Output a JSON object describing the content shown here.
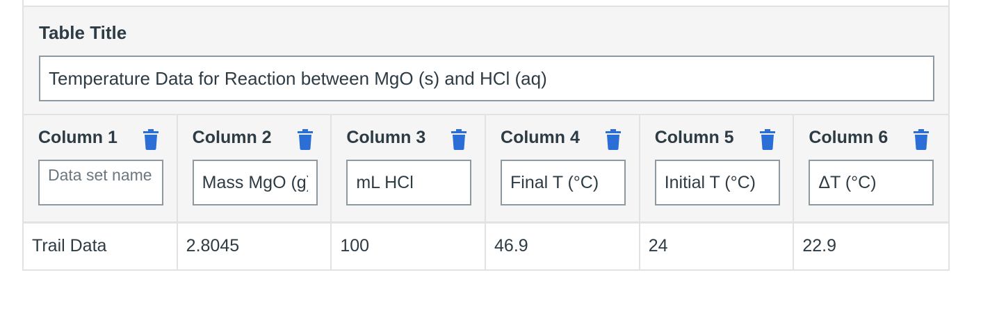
{
  "table": {
    "title_label": "Table Title",
    "title_value": "Temperature Data for Reaction between MgO (s) and HCl (aq)",
    "columns": [
      {
        "label": "Column 1",
        "value": "",
        "placeholder": "Data set name"
      },
      {
        "label": "Column 2",
        "value": "Mass MgO (g)"
      },
      {
        "label": "Column 3",
        "value": "mL HCl"
      },
      {
        "label": "Column 4",
        "value": "Final T (°C)"
      },
      {
        "label": "Column 5",
        "value": "Initial T (°C)"
      },
      {
        "label": "Column 6",
        "value": "ΔT (°C)"
      }
    ],
    "rows": [
      [
        "Trail Data",
        "2.8045",
        "100",
        "46.9",
        "24",
        "22.9"
      ]
    ]
  },
  "icons": {
    "delete_column": "trash-icon"
  },
  "colors": {
    "accent": "#2b6fd6",
    "border": "#8e989f",
    "panel": "#f5f5f5"
  }
}
